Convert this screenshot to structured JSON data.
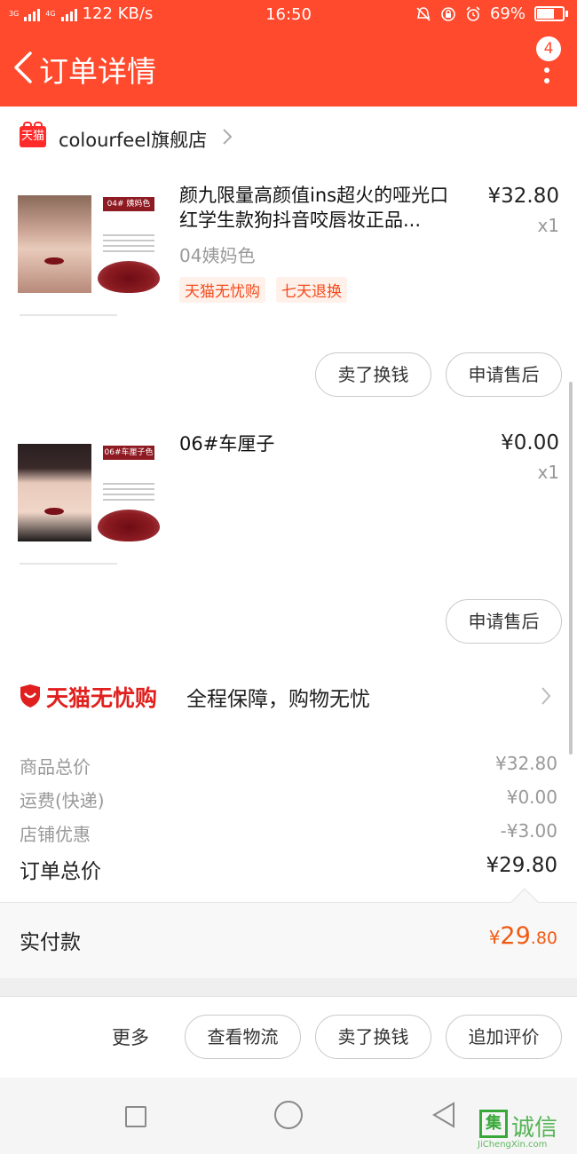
{
  "status_bar": {
    "net_tag_1": "3G",
    "net_tag_2": "4G",
    "speed": "122 KB/s",
    "time": "16:50",
    "battery_text": "69%",
    "battery_level": 0.69
  },
  "header": {
    "title": "订单详情",
    "badge_count": "4"
  },
  "store": {
    "logo_text": "天猫",
    "name": "colourfeel旗舰店"
  },
  "products": [
    {
      "title": "颜九限量高颜值ins超火的哑光口红学生款狗抖音咬唇妆正品...",
      "price": "¥32.80",
      "qty": "x1",
      "sku": "04姨妈色",
      "tags": [
        "天猫无忧购",
        "七天退换"
      ],
      "thumb_shade": "04# 姨妈色",
      "buttons": [
        "卖了换钱",
        "申请售后"
      ]
    },
    {
      "title": "06#车厘子",
      "price": "¥0.00",
      "qty": "x1",
      "thumb_shade": "06#车厘子色",
      "buttons": [
        "申请售后"
      ]
    }
  ],
  "promo": {
    "brand": "天猫无忧购",
    "text": "全程保障，购物无忧"
  },
  "summary": {
    "rows": [
      {
        "label": "商品总价",
        "value": "¥32.80"
      },
      {
        "label": "运费(快递)",
        "value": "¥0.00"
      },
      {
        "label": "店铺优惠",
        "value": "-¥3.00"
      }
    ],
    "total_label": "订单总价",
    "total_value": "¥29.80"
  },
  "paid": {
    "label": "实付款",
    "currency": "¥",
    "integer": "29",
    "decimal": ".80"
  },
  "actions": {
    "more": "更多",
    "buttons": [
      "查看物流",
      "卖了换钱",
      "追加评价"
    ]
  },
  "watermark": {
    "mark": "集",
    "text": "诚信",
    "sub": "JiChengXin.com"
  },
  "colors": {
    "brand": "#ff4a2d",
    "price_accent": "#f05a12",
    "tmall_red": "#e0201e"
  },
  "icons": [
    "back-arrow-icon",
    "more-vertical-icon",
    "chevron-right-icon",
    "shield-icon",
    "square-icon",
    "circle-icon",
    "triangle-back-icon"
  ]
}
